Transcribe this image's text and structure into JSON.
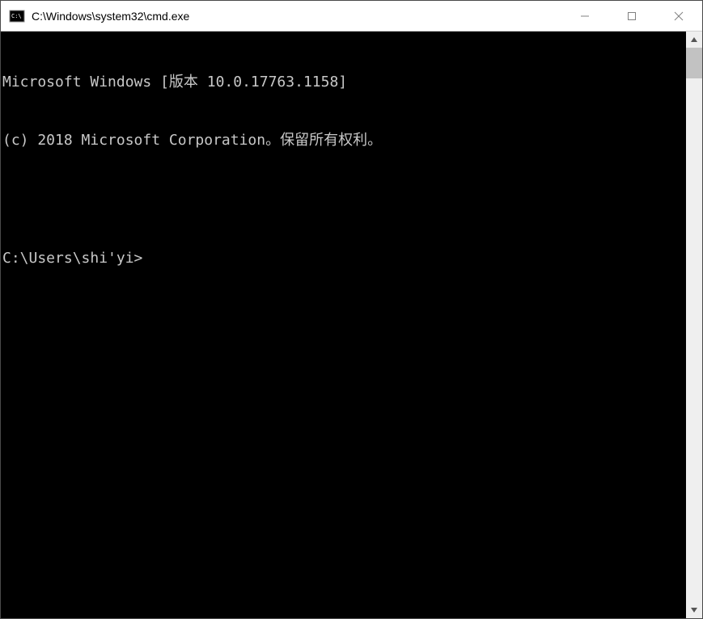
{
  "title": "C:\\Windows\\system32\\cmd.exe",
  "terminal": {
    "line1": "Microsoft Windows [版本 10.0.17763.1158]",
    "line2": "(c) 2018 Microsoft Corporation。保留所有权利。",
    "prompt": "C:\\Users\\shi'yi>"
  }
}
